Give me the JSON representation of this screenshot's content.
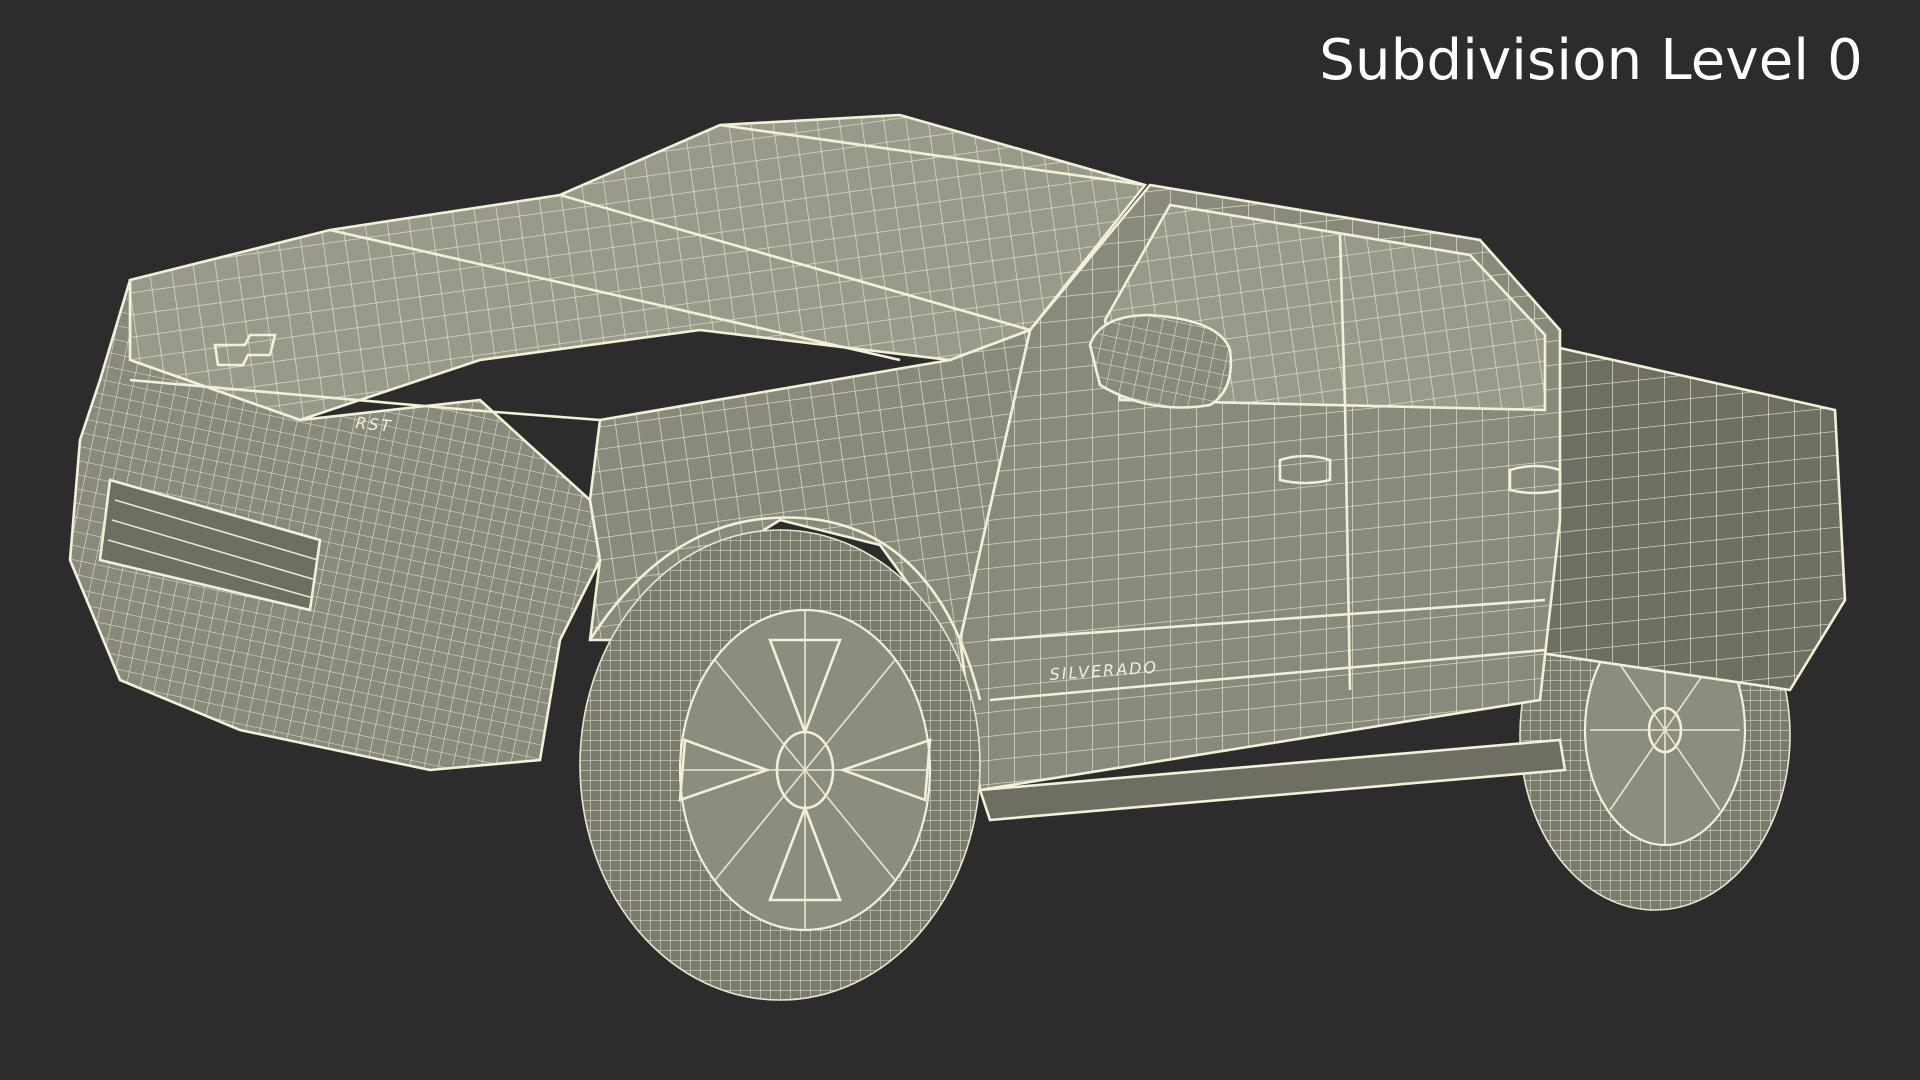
{
  "viewport": {
    "label": "Subdivision Level 0",
    "background_color": "#2c2c2c",
    "wireframe_color": "#e9e6cf",
    "surface_color": "#8a8a7c"
  },
  "model": {
    "badges": {
      "side": "SILVERADO",
      "front": "RST"
    }
  }
}
